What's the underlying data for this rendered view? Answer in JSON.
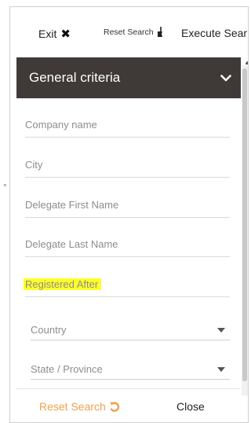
{
  "toolbar": {
    "exit_label": "Exit",
    "exit_icon": "close-x-icon",
    "reset_search_label": "Reset Search",
    "reset_search_icon": "broom-icon",
    "execute_search_label": "Execute Sear"
  },
  "panel": {
    "title": "General criteria",
    "expand_icon": "chevron-down-icon",
    "header_color": "#3f3a37"
  },
  "fields": {
    "company_name": "Company name",
    "city": "City",
    "delegate_first_name": "Delegate First Name",
    "delegate_last_name": "Delegate Last Name",
    "registered_after": "Registered After",
    "highlight_color": "#ffff2a"
  },
  "selects": {
    "country": "Country",
    "state_province": "State / Province"
  },
  "footer": {
    "reset_search_label": "Reset Search",
    "reset_icon": "undo-icon",
    "reset_color": "#f0a04b",
    "close_label": "Close"
  }
}
